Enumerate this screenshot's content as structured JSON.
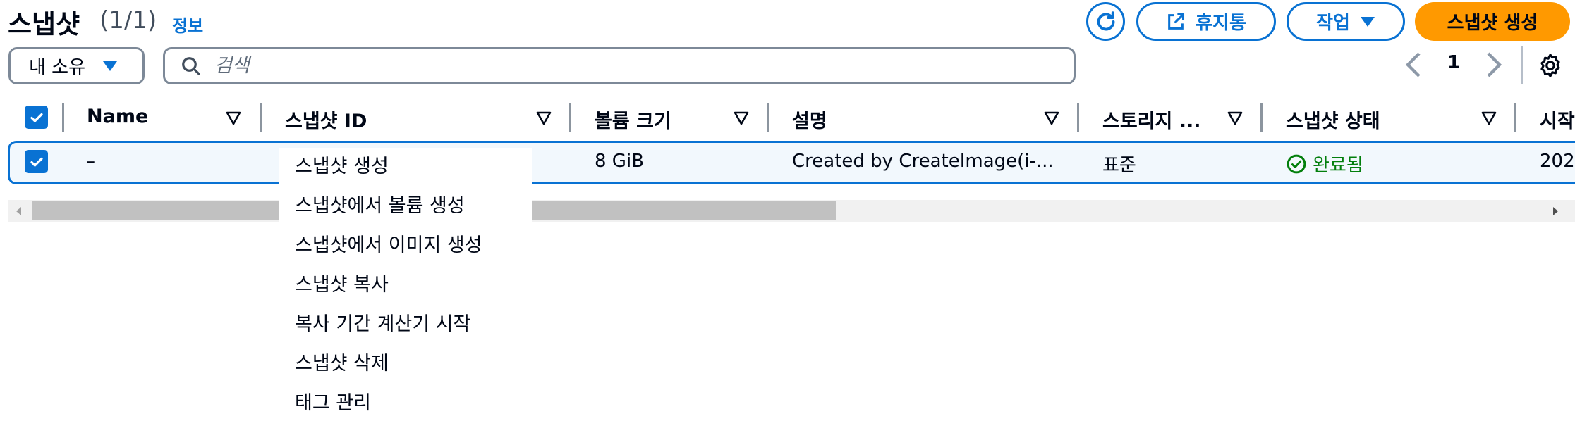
{
  "header": {
    "title": "스냅샷",
    "count": "(1/1)",
    "info_link": "정보",
    "refresh_icon": "refresh-icon",
    "recycle_bin_label": "휴지통",
    "recycle_bin_icon": "external-link-icon",
    "actions_label": "작업",
    "create_snapshot_label": "스냅샷 생성"
  },
  "filter": {
    "owner_value": "내 소유",
    "search_placeholder": "검색"
  },
  "pagination": {
    "current_page": "1"
  },
  "table": {
    "columns": [
      "Name",
      "스냅샷 ID",
      "볼륨 크기",
      "설명",
      "스토리지 ...",
      "스냅샷 상태",
      "시작"
    ],
    "rows": [
      {
        "selected": true,
        "name": "–",
        "snapshot_id": "",
        "volume_size": "8 GiB",
        "description": "Created by CreateImage(i-...",
        "storage_tier": "표준",
        "status": "완료됨",
        "started": "202"
      }
    ]
  },
  "context_menu": {
    "items": [
      "스냅샷 생성",
      "스냅샷에서 볼륨 생성",
      "스냅샷에서 이미지 생성",
      "스냅샷 복사",
      "복사 기간 계산기 시작",
      "스냅샷 삭제",
      "태그 관리"
    ]
  },
  "colors": {
    "accent": "#0972d3",
    "primary_button": "#ff9900",
    "success": "#037f0c",
    "selected_row_bg": "#f2f8fd"
  }
}
